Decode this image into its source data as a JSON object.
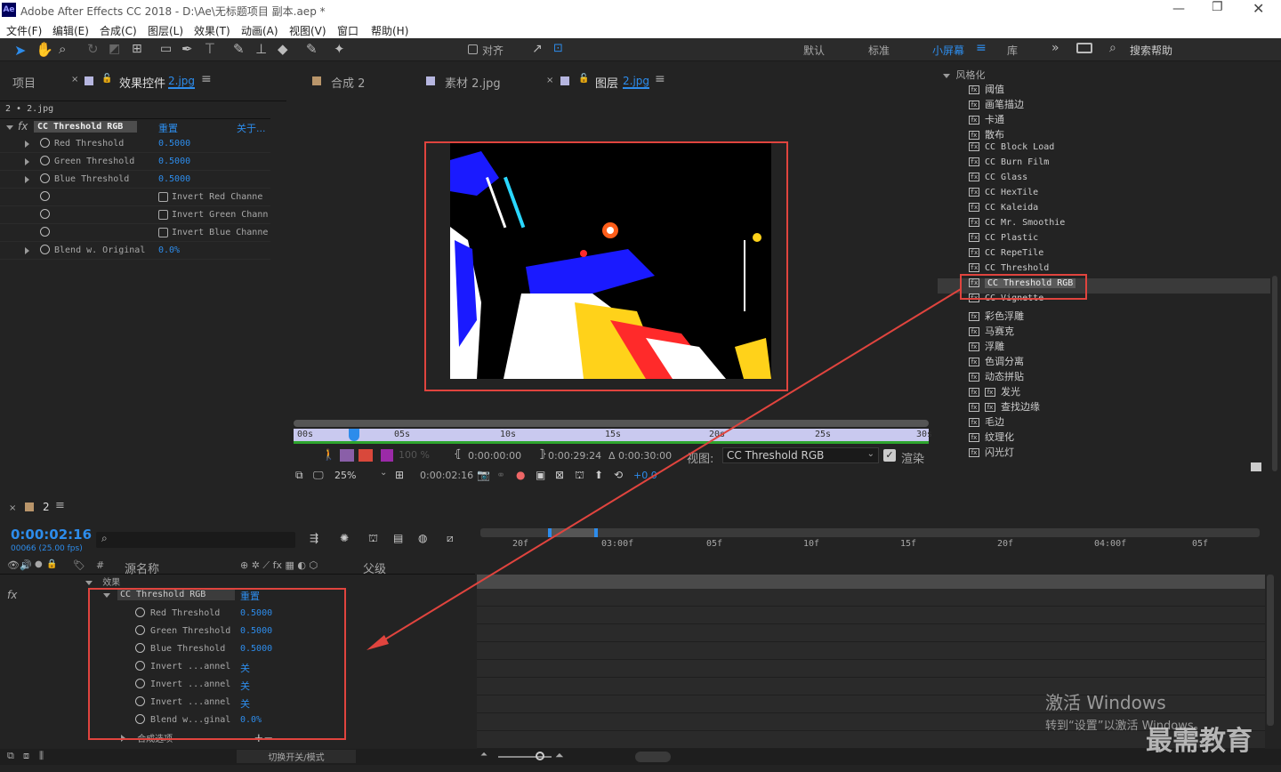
{
  "title_bar": {
    "app_icon": "Ae",
    "title": "Adobe After Effects CC 2018 - D:\\Ae\\无标题项目 副本.aep *"
  },
  "menu": [
    "文件(F)",
    "编辑(E)",
    "合成(C)",
    "图层(L)",
    "效果(T)",
    "动画(A)",
    "视图(V)",
    "窗口",
    "帮助(H)"
  ],
  "toolbar": {
    "align_label": "对齐",
    "workspaces": [
      "默认",
      "标准",
      "小屏幕",
      "库"
    ],
    "search_placeholder": "搜索帮助"
  },
  "left_panel": {
    "tab_project": "项目",
    "tab_effects": "效果控件",
    "tab_effects_layer": "2.jpg",
    "breadcrumb": "2 • 2.jpg",
    "effect_name": "CC Threshold RGB",
    "reset": "重置",
    "about": "关于...",
    "rows": [
      {
        "label": "Red Threshold",
        "value": "0.5000"
      },
      {
        "label": "Green Threshold",
        "value": "0.5000"
      },
      {
        "label": "Blue Threshold",
        "value": "0.5000"
      },
      {
        "label": "",
        "value": "Invert Red Channe",
        "check": true
      },
      {
        "label": "",
        "value": "Invert Green Chann",
        "check": true
      },
      {
        "label": "",
        "value": "Invert Blue Channe",
        "check": true
      },
      {
        "label": "Blend w. Original",
        "value": "0.0%"
      }
    ]
  },
  "viewer": {
    "tabs": [
      {
        "label": "合成 2"
      },
      {
        "label": "素材 2.jpg"
      },
      {
        "label": "图层",
        "suffix": "2.jpg"
      }
    ],
    "ruler": [
      "00s",
      "05s",
      "10s",
      "15s",
      "20s",
      "25s",
      "30s"
    ],
    "time_start": "0:00:00:00",
    "time_end": "0:00:29:24",
    "duration": "Δ 0:00:30:00",
    "view_label": "视图:",
    "view_value": "CC Threshold RGB",
    "render_label": "渲染",
    "opacity": "100 %",
    "zoom": "25%",
    "current_time": "0:00:02:16",
    "exposure": "+0.0"
  },
  "effects_panel": {
    "category": "风格化",
    "items": [
      "阈值",
      "画笔描边",
      "卡通",
      "散布",
      "CC Block Load",
      "CC Burn Film",
      "CC Glass",
      "CC HexTile",
      "CC Kaleida",
      "CC Mr. Smoothie",
      "CC Plastic",
      "CC RepeTile",
      "CC Threshold",
      "CC Threshold RGB",
      "CC Vignette",
      "彩色浮雕",
      "马赛克",
      "浮雕",
      "色调分离",
      "动态拼贴",
      "发光",
      "查找边缘",
      "毛边",
      "纹理化",
      "闪光灯"
    ],
    "selected": "CC Threshold RGB"
  },
  "timeline": {
    "comp_name": "2",
    "timecode": "0:00:02:16",
    "fps_info": "00066 (25.00 fps)",
    "col_name": "源名称",
    "col_parent": "父级",
    "effects_group": "效果",
    "effect_name": "CC Threshold RGB",
    "reset": "重置",
    "rows": [
      {
        "label": "Red Threshold",
        "value": "0.5000"
      },
      {
        "label": "Green Threshold",
        "value": "0.5000"
      },
      {
        "label": "Blue Threshold",
        "value": "0.5000"
      },
      {
        "label": "Invert ...annel",
        "value": "关"
      },
      {
        "label": "Invert ...annel",
        "value": "关"
      },
      {
        "label": "Invert ...annel",
        "value": "关"
      },
      {
        "label": "Blend w...ginal",
        "value": "0.0%"
      }
    ],
    "composite_options": "合成选项",
    "ruler": [
      "20f",
      "03:00f",
      "05f",
      "10f",
      "15f",
      "20f",
      "04:00f",
      "05f"
    ],
    "toggle_label": "切换开关/模式"
  },
  "watermark": {
    "line1": "激活 Windows",
    "line2": "转到“设置”以激活 Windows。",
    "brand": "最需教育"
  },
  "colors": {
    "accent": "#2d8ceb",
    "highlight": "#e0443e",
    "bg": "#232323"
  }
}
